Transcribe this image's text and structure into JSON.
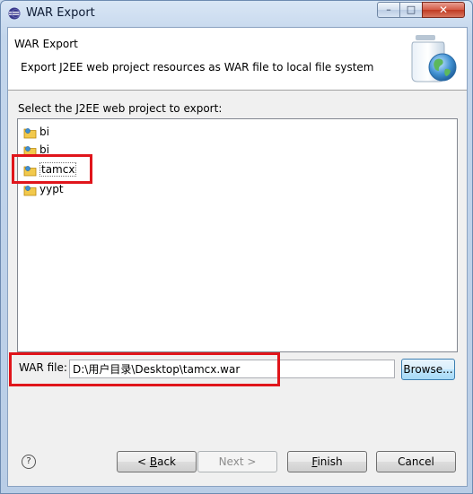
{
  "window": {
    "title": "WAR Export",
    "minimize_glyph": "–",
    "maximize_glyph": "□",
    "close_glyph": "✕"
  },
  "banner": {
    "title": "WAR Export",
    "description": "Export J2EE web project resources as WAR file to local file system",
    "image_icon": "jar-globe-icon"
  },
  "project_section": {
    "label": "Select the J2EE web project to export:",
    "items": [
      {
        "label": "bi",
        "icon": "web-project-folder-icon"
      },
      {
        "label": "bi",
        "icon": "web-project-folder-icon"
      },
      {
        "label": "tamcx",
        "icon": "web-project-folder-icon",
        "selected": true
      },
      {
        "label": "yypt",
        "icon": "web-project-folder-icon"
      }
    ]
  },
  "war_file": {
    "label": "WAR file:",
    "value": "D:\\用户目录\\Desktop\\tamcx.war",
    "browse_label": "Browse..."
  },
  "footer": {
    "help_glyph": "?",
    "back_label": "< ",
    "back_mnemonic": "B",
    "back_rest": "ack",
    "next_label": "Next >",
    "finish_mnemonic": "F",
    "finish_rest": "inish",
    "cancel_label": "Cancel"
  },
  "colors": {
    "highlight_box": "#e0151b",
    "focused_button": "#3c7fb1"
  }
}
